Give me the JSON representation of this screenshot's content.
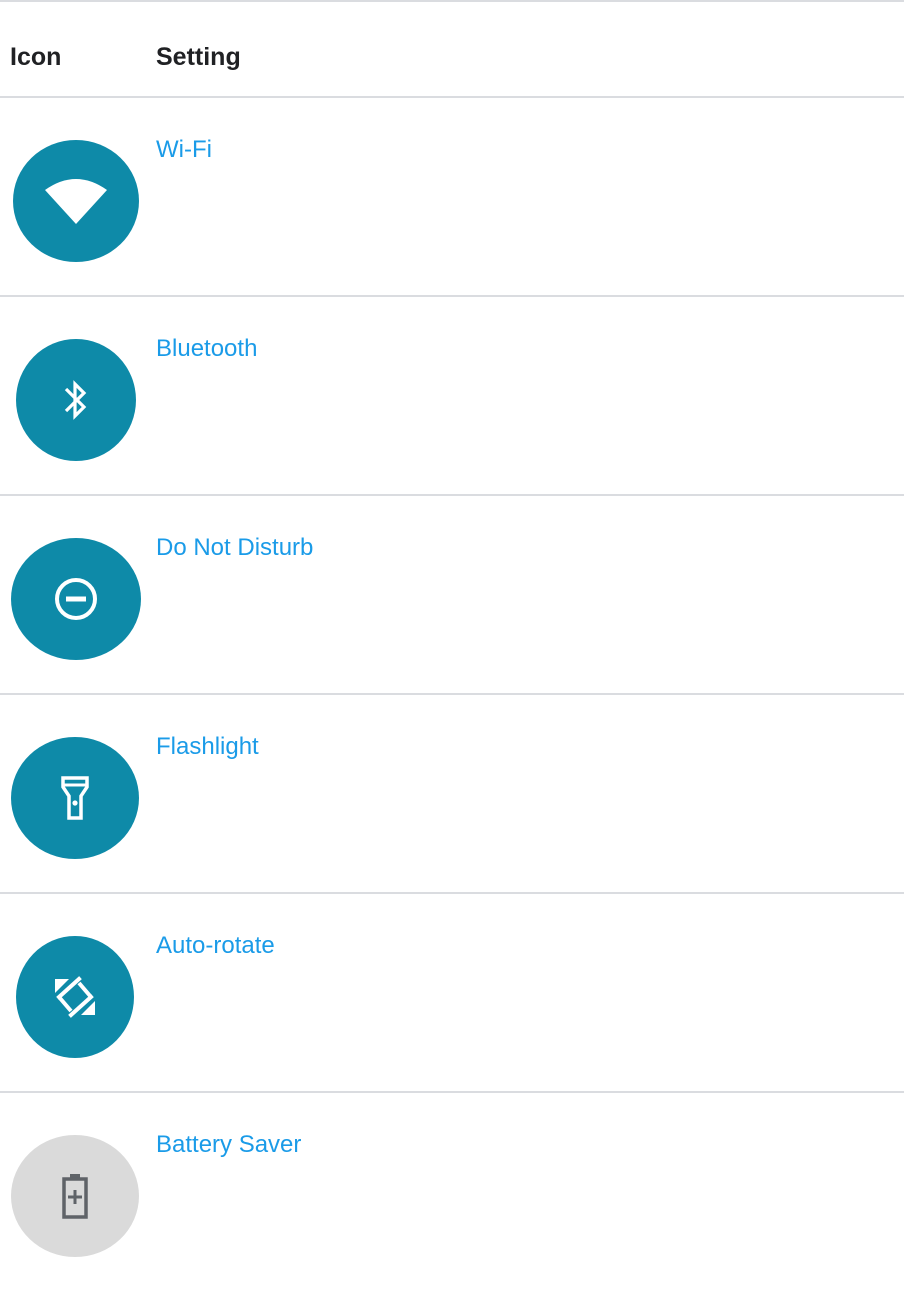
{
  "table": {
    "headers": {
      "icon": "Icon",
      "setting": "Setting"
    },
    "rows": [
      {
        "label": "Wi-Fi",
        "icon": "wifi-icon",
        "icon_bg": "#0e8aa8",
        "icon_fg": "#ffffff"
      },
      {
        "label": "Bluetooth",
        "icon": "bluetooth-icon",
        "icon_bg": "#0e8aa8",
        "icon_fg": "#ffffff"
      },
      {
        "label": "Do Not Disturb",
        "icon": "do-not-disturb-icon",
        "icon_bg": "#0e8aa8",
        "icon_fg": "#ffffff"
      },
      {
        "label": "Flashlight",
        "icon": "flashlight-icon",
        "icon_bg": "#0e8aa8",
        "icon_fg": "#ffffff"
      },
      {
        "label": "Auto-rotate",
        "icon": "auto-rotate-icon",
        "icon_bg": "#0e8aa8",
        "icon_fg": "#ffffff"
      },
      {
        "label": "Battery Saver",
        "icon": "battery-saver-icon",
        "icon_bg": "#dadada",
        "icon_fg": "#5f6368"
      }
    ]
  },
  "colors": {
    "link": "#1a9be8",
    "divider": "#dadce0",
    "header_text": "#202124"
  }
}
